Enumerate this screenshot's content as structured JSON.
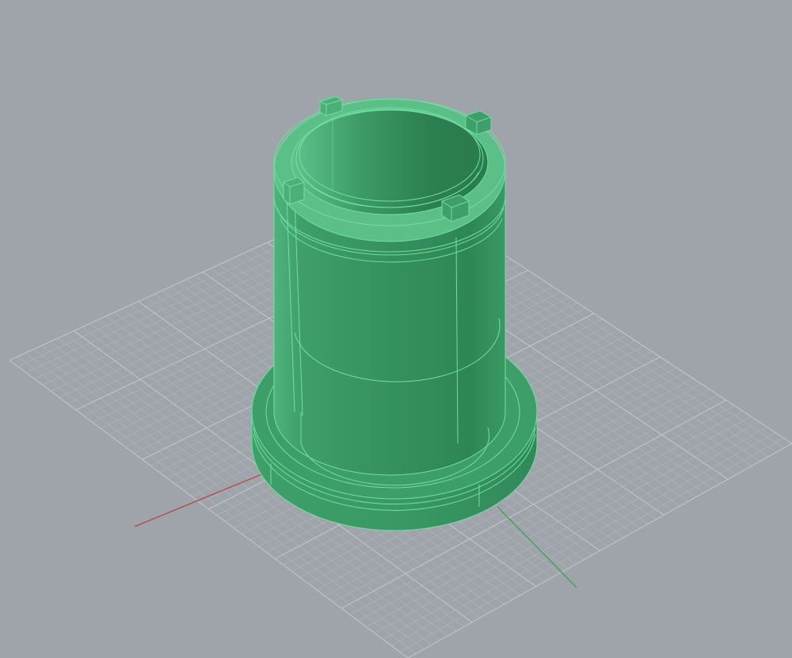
{
  "viewport": {
    "background_color": "#9fa3aa",
    "grid_minor_color": "#b3b7bd",
    "grid_major_color": "#c4c8cd",
    "x_axis_color": "#b84a45",
    "y_axis_color": "#3fa356"
  },
  "model": {
    "shade_color": "#3f9e6b",
    "edge_color": "#6fe0a0",
    "top_color": "#5bbf87"
  }
}
